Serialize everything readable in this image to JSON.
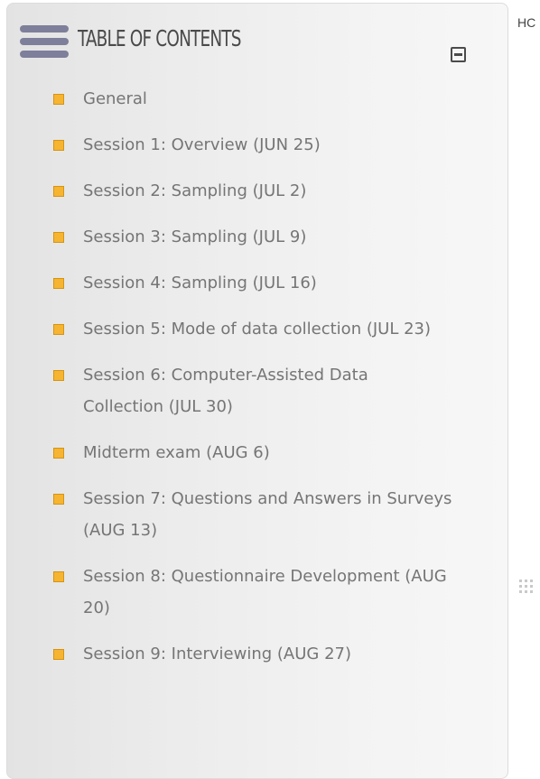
{
  "toc": {
    "title": "TABLE OF CONTENTS",
    "items": [
      {
        "label": "General"
      },
      {
        "label": "Session 1: Overview (JUN 25)"
      },
      {
        "label": "Session 2: Sampling (JUL 2)"
      },
      {
        "label": "Session 3: Sampling (JUL 9)"
      },
      {
        "label": "Session 4: Sampling (JUL 16)"
      },
      {
        "label": "Session 5: Mode of data collection (JUL 23)"
      },
      {
        "label": "Session 6: Computer-Assisted Data Collection (JUL 30)"
      },
      {
        "label": "Midterm exam (AUG 6)"
      },
      {
        "label": "Session 7: Questions and Answers in Surveys (AUG 13)"
      },
      {
        "label": "Session 8: Questionnaire Development (AUG 20)"
      },
      {
        "label": "Session 9: Interviewing (AUG 27)"
      }
    ]
  },
  "side": {
    "text": "HC"
  },
  "colors": {
    "bullet": "#f5b432",
    "menu_icon": "#7e7f9a",
    "item_text": "#757575"
  },
  "icons": {
    "menu": "hamburger-menu-icon",
    "collapse": "collapse-minus-icon",
    "bullet": "square-bullet-icon",
    "resize": "drag-grip-icon"
  }
}
